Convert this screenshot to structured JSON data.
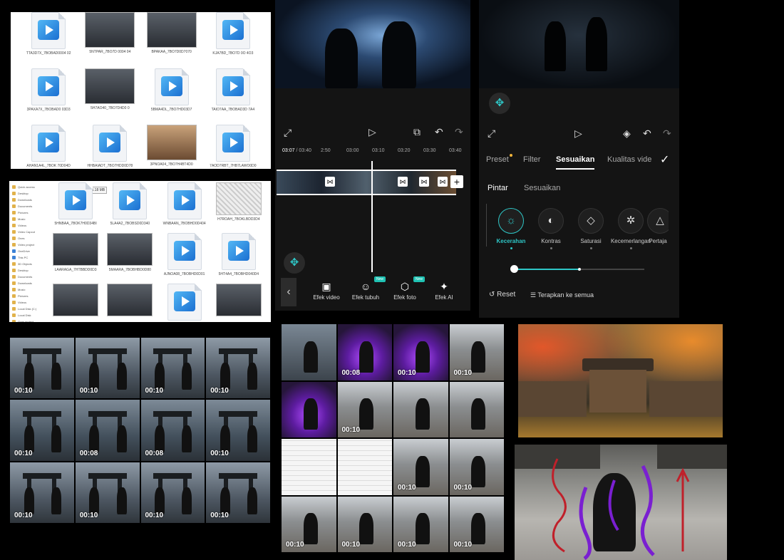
{
  "explorer_top": {
    "icons": [
      {
        "kind": "doc",
        "name": "TTA3D7X_7BOBAD0004 02"
      },
      {
        "kind": "thumb",
        "name": "5NTPAR_7BO7D 0004 04"
      },
      {
        "kind": "thumb",
        "name": "BPAKAA_7BO7D0D7070"
      },
      {
        "kind": "doc",
        "name": "KJA7BD_7BO7D 0O 4O3"
      },
      {
        "kind": "doc",
        "name": "3PAXA7X_7BOBAD0 03D3"
      },
      {
        "kind": "thumb",
        "name": "5H7AO40_7BO7D4D0 0"
      },
      {
        "kind": "doc",
        "name": "5BMA4DL_7BO7HD03D7"
      },
      {
        "kind": "doc",
        "name": "TAIO7AA_7BOBAD3D 7A4"
      },
      {
        "kind": "doc",
        "name": "AHAN1A4L_7BOK 70D04D"
      },
      {
        "kind": "doc",
        "name": "HHBAIADT_7BO7HDD0D78"
      },
      {
        "kind": "thumb-warm",
        "name": "3PNOA04_7BO7H4BT4D0"
      },
      {
        "kind": "doc",
        "name": "7AOD7RBT_7HB7LAWO0D0"
      }
    ]
  },
  "explorer_mid": {
    "sidebar": [
      "Quick access",
      "Desktop",
      "Downloads",
      "Documents",
      "Pictures",
      "Music",
      "Videos",
      "Video Capcut",
      "Ones",
      "Video project",
      "OneDrive",
      "This PC",
      "3D Objects",
      "Desktop",
      "Documents",
      "Downloads",
      "Music",
      "Pictures",
      "Videos",
      "Local Disk (C:)",
      "Local Disk",
      "Gran project",
      "Gran project",
      "Network"
    ],
    "tooltip": "Size: 5.18 MB",
    "icons": [
      {
        "kind": "doc",
        "name": "5HNBAA_7BOK7H0D34BI"
      },
      {
        "kind": "doc",
        "name": "5LA4A2_7BOBSD0D340"
      },
      {
        "kind": "doc",
        "name": "WNBAAN_7BOBHD0D404"
      },
      {
        "kind": "thumb-sketch",
        "name": "H7ROAH_7BOKLBDD3D4"
      },
      {
        "kind": "thumb",
        "name": "LAARAGA_7HTBBDD0D3"
      },
      {
        "kind": "thumb",
        "name": "5MAARA_7BOBHBD0D80"
      },
      {
        "kind": "doc",
        "name": "AJNOA08_7BOBHD0D01"
      },
      {
        "kind": "doc",
        "name": "5HT4A4_7BOBHD040D4"
      },
      {
        "kind": "thumb",
        "name": ""
      },
      {
        "kind": "thumb",
        "name": ""
      },
      {
        "kind": "doc",
        "name": ""
      },
      {
        "kind": "thumb",
        "name": ""
      }
    ]
  },
  "editor_left": {
    "time_current": "03:07",
    "time_total": "03:40",
    "ruler_marks": [
      "2:50",
      "03:00",
      "03:10",
      "03:20",
      "03:30",
      "03:40"
    ],
    "tools": [
      {
        "label": "Efek video",
        "icon": "▣",
        "new": false
      },
      {
        "label": "Efek tubuh",
        "icon": "☺",
        "new": true
      },
      {
        "label": "Efek foto",
        "icon": "⬡",
        "new": true
      },
      {
        "label": "Efek AI",
        "icon": "✦",
        "new": false
      }
    ],
    "new_badge": "New"
  },
  "editor_right": {
    "tabs": [
      "Preset",
      "Filter",
      "Sesuaikan",
      "Kualitas vide"
    ],
    "active_tab": "Sesuaikan",
    "subtabs": [
      "Pintar",
      "Sesuaikan"
    ],
    "adjust_items": [
      {
        "label": "Kecerahan",
        "icon": "☼",
        "selected": true
      },
      {
        "label": "Kontras",
        "icon": "◐",
        "selected": false
      },
      {
        "label": "Saturasi",
        "icon": "◇",
        "selected": false
      },
      {
        "label": "Kecemerlangan",
        "icon": "✲",
        "selected": false
      },
      {
        "label": "Pertaja",
        "icon": "△",
        "selected": false
      }
    ],
    "slider_value": 0,
    "reset_label": "Reset",
    "apply_all_label": "Terapkan ke semua"
  },
  "grid_left": {
    "clips": [
      "00:10",
      "00:10",
      "00:10",
      "00:10",
      "00:10",
      "00:08",
      "00:08",
      "00:10",
      "00:10",
      "00:10",
      "00:10",
      "00:10"
    ]
  },
  "grid_mid": {
    "clips": [
      {
        "dur": "",
        "style": "dusk"
      },
      {
        "dur": "00:08",
        "style": "purple"
      },
      {
        "dur": "00:10",
        "style": "purple"
      },
      {
        "dur": "00:10",
        "style": "village"
      },
      {
        "dur": "",
        "style": "purple"
      },
      {
        "dur": "00:10",
        "style": "village"
      },
      {
        "dur": "",
        "style": "village"
      },
      {
        "dur": "",
        "style": "village"
      },
      {
        "dur": "",
        "style": "sketch"
      },
      {
        "dur": "",
        "style": "sketch"
      },
      {
        "dur": "00:10",
        "style": "village"
      },
      {
        "dur": "00:10",
        "style": "village"
      },
      {
        "dur": "00:10",
        "style": "village"
      },
      {
        "dur": "00:10",
        "style": "village"
      },
      {
        "dur": "00:10",
        "style": "village"
      },
      {
        "dur": "00:10",
        "style": "village"
      }
    ]
  }
}
